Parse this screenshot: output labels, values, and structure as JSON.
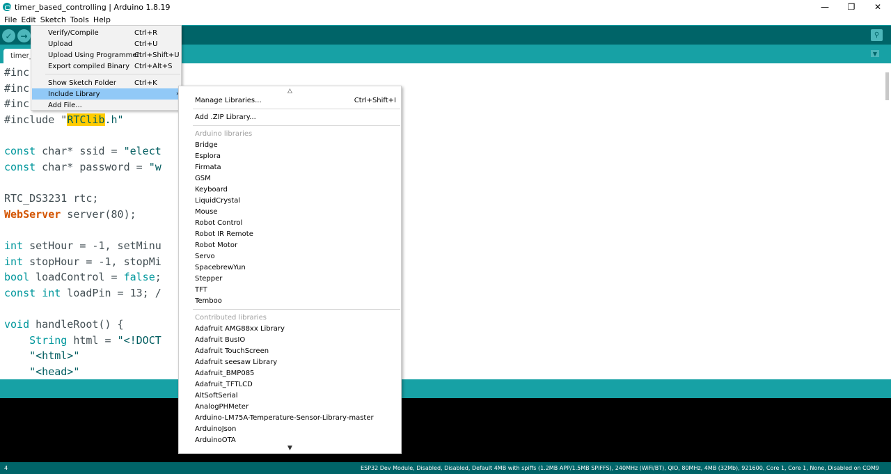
{
  "window": {
    "title": "timer_based_controlling | Arduino 1.8.19",
    "controls": [
      "—",
      "❐",
      "✕"
    ]
  },
  "menubar": [
    "File",
    "Edit",
    "Sketch",
    "Tools",
    "Help"
  ],
  "toolbar": {
    "verify_icon": "✓",
    "upload_icon": "→",
    "serial_icon": "⚲"
  },
  "tab": {
    "label": "timer_",
    "menu_icon": "▼"
  },
  "code": {
    "l1": "#inc",
    "l2": "#inc",
    "l3": "#inc",
    "l4_a": "#include \"",
    "l4_b": "RTClib",
    "l4_c": ".h\"",
    "l5_a": "const",
    "l5_b": " char* ssid = ",
    "l5_c": "\"elect",
    "l6_a": "const",
    "l6_b": " char* password = ",
    "l6_c": "\"w",
    "l7": "RTC_DS3231 rtc;",
    "l8_a": "WebServer",
    "l8_b": " server(80);",
    "l9_a": "int",
    "l9_b": " setHour = -1, setMinu",
    "l10_a": "int",
    "l10_b": " stopHour = -1, stopMi",
    "l11_a": "bool",
    "l11_b": " loadControl = ",
    "l11_c": "false",
    "l11_d": ";",
    "l12_a": "const",
    "l12_b": " ",
    "l12_c": "int",
    "l12_d": " loadPin = 13; /",
    "l13_a": "void",
    "l13_b": " handleRoot() {",
    "l14_a": "    ",
    "l14_b": "String",
    "l14_c": " html = ",
    "l14_d": "\"<!DOCT",
    "l15": "    \"<html>\"",
    "l16": "    \"<head>\""
  },
  "sketch_menu": {
    "verify": {
      "label": "Verify/Compile",
      "shortcut": "Ctrl+R"
    },
    "upload": {
      "label": "Upload",
      "shortcut": "Ctrl+U"
    },
    "upload_prog": {
      "label": "Upload Using Programmer",
      "shortcut": "Ctrl+Shift+U"
    },
    "export": {
      "label": "Export compiled Binary",
      "shortcut": "Ctrl+Alt+S"
    },
    "show_folder": {
      "label": "Show Sketch Folder",
      "shortcut": "Ctrl+K"
    },
    "include_library": {
      "label": "Include Library",
      "arrow": "›"
    },
    "add_file": {
      "label": "Add File..."
    }
  },
  "library_menu": {
    "scroll_up": "△",
    "scroll_down": "▼",
    "manage": {
      "label": "Manage Libraries...",
      "shortcut": "Ctrl+Shift+I"
    },
    "add_zip": "Add .ZIP Library...",
    "arduino_header": "Arduino libraries",
    "arduino_libs": [
      "Bridge",
      "Esplora",
      "Firmata",
      "GSM",
      "Keyboard",
      "LiquidCrystal",
      "Mouse",
      "Robot Control",
      "Robot IR Remote",
      "Robot Motor",
      "Servo",
      "SpacebrewYun",
      "Stepper",
      "TFT",
      "Temboo"
    ],
    "contributed_header": "Contributed libraries",
    "contributed_libs": [
      "Adafruit AMG88xx Library",
      "Adafruit BusIO",
      "Adafruit TouchScreen",
      "Adafruit seesaw Library",
      "Adafruit_BMP085",
      "Adafruit_TFTLCD",
      "AltSoftSerial",
      "AnalogPHMeter",
      "Arduino-LM75A-Temperature-Sensor-Library-master",
      "ArduinoJson",
      "ArduinoOTA"
    ]
  },
  "status": {
    "line": "4",
    "board": "ESP32 Dev Module, Disabled, Disabled, Default 4MB with spiffs (1.2MB APP/1.5MB SPIFFS), 240MHz (WiFi/BT), QIO, 80MHz, 4MB (32Mb), 921600, Core 1, Core 1, None, Disabled on COM9"
  },
  "colors": {
    "toolbar": "#006468",
    "tabbar": "#17a1a5",
    "highlight": "#ffcc00",
    "menu_active": "#91c9f7"
  }
}
